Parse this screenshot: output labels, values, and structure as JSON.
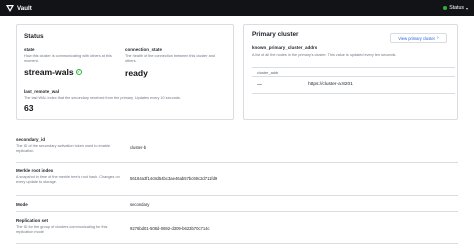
{
  "app": {
    "brand": "Vault",
    "status_label": "Status",
    "status_color": "#2eb039"
  },
  "status_card": {
    "title": "Status",
    "state": {
      "label": "state",
      "help": "How this cluster is communicating with others at this moment.",
      "value": "stream-wals"
    },
    "connection_state": {
      "label": "connection_state",
      "help": "The health of the connection between this cluster and others.",
      "value": "ready"
    },
    "last_remote_wal": {
      "label": "last_remote_wal",
      "help": "The last WAL index that the secondary received from the primary. Updates every 10 seconds.",
      "value": "63"
    }
  },
  "primary_cluster": {
    "title": "Primary cluster",
    "button_label": "View primary cluster",
    "addrs_label": "known_primary_cluster_addrs",
    "addrs_help": "A list of all the nodes in the primary's cluster. This value is updated every ten seconds.",
    "table_header": "cluster_addr",
    "rows": [
      {
        "marker": "—",
        "addr": "https://cluster-a:8201"
      }
    ]
  },
  "details": [
    {
      "label": "secondary_id",
      "help": "The ID of the secondary activation token used to enable replication.",
      "value": "cluster-b"
    },
    {
      "label": "Merkle root index",
      "help": "A snapshot in time of the merkle tree's root hash. Changes on every update to storage.",
      "value": "56184a3f14c8d54bc3ae46ab57bc69c2d711fd9"
    },
    {
      "label": "Mode",
      "help": "",
      "value": "secondary"
    },
    {
      "label": "Replication set",
      "help": "The ID for the group of clusters communicating for this replication mode",
      "value": "9276bd01-508d-0692-d309-b623b70c714c"
    }
  ]
}
